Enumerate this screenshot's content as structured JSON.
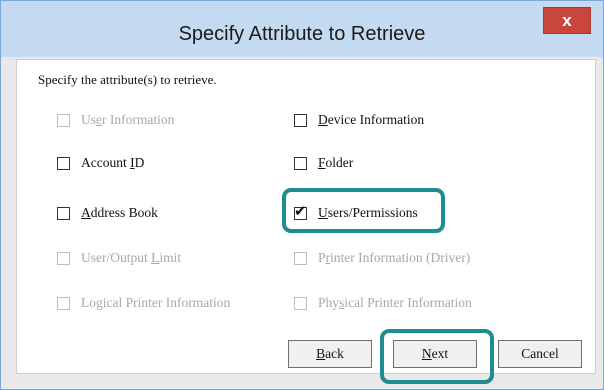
{
  "dialog": {
    "title": "Specify Attribute to Retrieve",
    "close_label": "x",
    "instruction": "Specify the attribute(s) to retrieve."
  },
  "checkboxes": {
    "user_info": {
      "pre": "Us",
      "acc": "e",
      "post": "r Information",
      "checked": false,
      "enabled": false
    },
    "device_info": {
      "pre": "",
      "acc": "D",
      "post": "evice Information",
      "checked": false,
      "enabled": true
    },
    "account_id": {
      "pre": "Account ",
      "acc": "I",
      "post": "D",
      "checked": false,
      "enabled": true
    },
    "folder": {
      "pre": "",
      "acc": "F",
      "post": "older",
      "checked": false,
      "enabled": true
    },
    "address_book": {
      "pre": "",
      "acc": "A",
      "post": "ddress Book",
      "checked": false,
      "enabled": true
    },
    "users_permissions": {
      "pre": "",
      "acc": "U",
      "post": "sers/Permissions",
      "checked": true,
      "enabled": true
    },
    "user_output_limit": {
      "pre": "User/Output ",
      "acc": "L",
      "post": "imit",
      "checked": false,
      "enabled": false
    },
    "printer_info_driver": {
      "pre": "P",
      "acc": "r",
      "post": "inter Information (Driver)",
      "checked": false,
      "enabled": false
    },
    "logical_printer_info": {
      "pre": "Lo",
      "acc": "g",
      "post": "ical Printer Information",
      "checked": false,
      "enabled": false
    },
    "physical_printer_info": {
      "pre": "Phy",
      "acc": "s",
      "post": "ical Printer Information",
      "checked": false,
      "enabled": false
    }
  },
  "check_glyph": "✔",
  "buttons": {
    "back": {
      "acc": "B",
      "post": "ack"
    },
    "next": {
      "acc": "N",
      "post": "ext"
    },
    "cancel": {
      "label": "Cancel"
    }
  },
  "highlight_color": "#1f8c91"
}
